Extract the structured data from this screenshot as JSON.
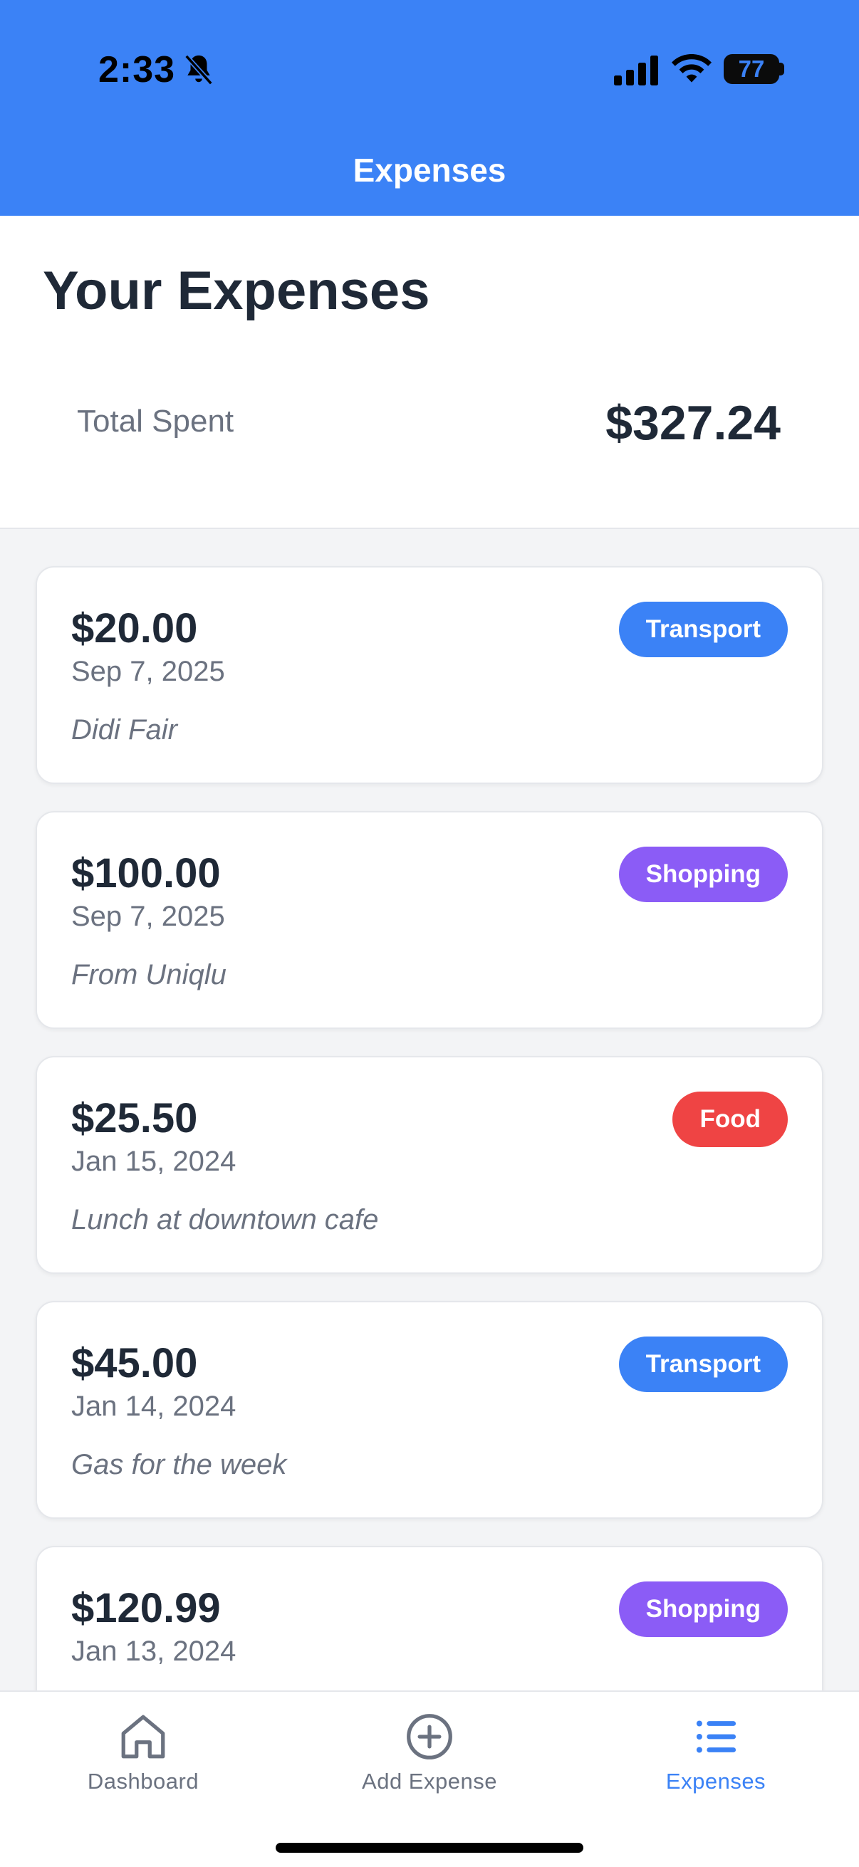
{
  "status_bar": {
    "time": "2:33",
    "battery": "77",
    "icons": [
      "bell-slash-icon",
      "signal-icon",
      "wifi-icon",
      "battery-icon"
    ]
  },
  "nav": {
    "title": "Expenses"
  },
  "summary": {
    "title": "Your Expenses",
    "total_label": "Total Spent",
    "total_value": "$327.24"
  },
  "expenses": [
    {
      "amount": "$20.00",
      "date": "Sep 7, 2025",
      "note": "Didi Fair",
      "category": "Transport"
    },
    {
      "amount": "$100.00",
      "date": "Sep 7, 2025",
      "note": "From Uniqlu",
      "category": "Shopping"
    },
    {
      "amount": "$25.50",
      "date": "Jan 15, 2024",
      "note": "Lunch at downtown cafe",
      "category": "Food"
    },
    {
      "amount": "$45.00",
      "date": "Jan 14, 2024",
      "note": "Gas for the week",
      "category": "Transport"
    },
    {
      "amount": "$120.99",
      "date": "Jan 13, 2024",
      "note": "",
      "category": "Shopping"
    }
  ],
  "category_colors": {
    "Transport": "#3b82f6",
    "Shopping": "#8b5cf6",
    "Food": "#ef4444"
  },
  "tabs": [
    {
      "label": "Dashboard",
      "icon": "home-icon",
      "active": false
    },
    {
      "label": "Add Expense",
      "icon": "plus-circle-icon",
      "active": false
    },
    {
      "label": "Expenses",
      "icon": "list-icon",
      "active": true
    }
  ],
  "colors": {
    "header": "#3b82f6",
    "active_tab": "#3b82f6",
    "inactive_tab": "#6b7280"
  }
}
